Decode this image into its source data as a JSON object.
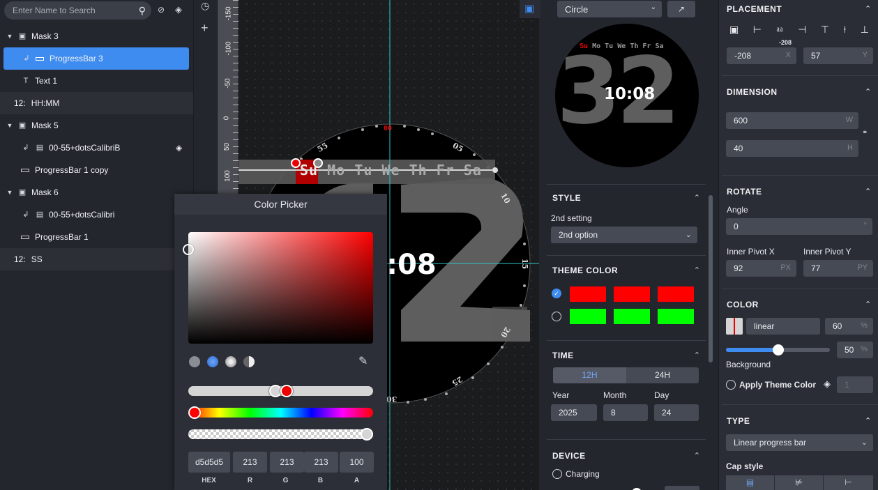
{
  "layers": {
    "search_placeholder": "Enter Name to Search",
    "items": [
      {
        "label": "Mask 3"
      },
      {
        "label": "ProgressBar 3"
      },
      {
        "label": "Text 1"
      },
      {
        "label": "HH:MM",
        "prefix": "12:"
      },
      {
        "label": "Mask 5"
      },
      {
        "label": "00-55+dotsCalibriB"
      },
      {
        "label": "ProgressBar 1 copy"
      },
      {
        "label": "Mask 6"
      },
      {
        "label": "00-55+dotsCalibri"
      },
      {
        "label": "ProgressBar 1"
      },
      {
        "label": "SS",
        "prefix": "12:"
      }
    ]
  },
  "ruler": {
    "ticks": [
      "-150",
      "-100",
      "-50",
      "0",
      "50",
      "100"
    ]
  },
  "canvas": {
    "weekdays": [
      "Su",
      "Mo",
      "Tu",
      "We",
      "Th",
      "Fr",
      "Sa"
    ],
    "time_partial": ":08",
    "big_digit": "2",
    "dial_labels": [
      "00",
      "05",
      "10",
      "15",
      "20",
      "25",
      "30",
      "55"
    ]
  },
  "color_picker": {
    "title": "Color Picker",
    "hex": "d5d5d5",
    "r": "213",
    "g": "213",
    "b": "213",
    "a": "100",
    "labels": {
      "hex": "HEX",
      "r": "R",
      "g": "G",
      "b": "B",
      "a": "A"
    },
    "hue_color": "#ff0000",
    "current_color": "#d5d5d5"
  },
  "preview": {
    "shape_select": "Circle",
    "time": "10:08",
    "big_digits": "32",
    "weekdays": [
      "Su",
      "Mo",
      "Tu",
      "We",
      "Th",
      "Fr",
      "Sa"
    ]
  },
  "style": {
    "header": "STYLE",
    "setting_label": "2nd setting",
    "option": "2nd option"
  },
  "theme": {
    "header": "THEME COLOR",
    "row1": [
      "#ff0000",
      "#ff0000",
      "#ff0000"
    ],
    "row2": [
      "#00ff00",
      "#00ff00",
      "#00ff00"
    ]
  },
  "time": {
    "header": "TIME",
    "mode_12": "12H",
    "mode_24": "24H",
    "year_label": "Year",
    "year": "2025",
    "month_label": "Month",
    "month": "8",
    "day_label": "Day",
    "day": "24"
  },
  "device": {
    "header": "DEVICE",
    "charging": "Charging"
  },
  "placement": {
    "header": "PLACEMENT",
    "x_hint": "-208",
    "x": "-208",
    "x_unit": "X",
    "y": "57",
    "y_unit": "Y"
  },
  "dimension": {
    "header": "DIMENSION",
    "w": "600",
    "w_unit": "W",
    "h": "40",
    "h_unit": "H"
  },
  "rotate": {
    "header": "ROTATE",
    "angle_label": "Angle",
    "angle": "0",
    "angle_unit": "°",
    "pivot_x_label": "Inner Pivot X",
    "pivot_x": "92",
    "pivot_x_unit": "PX",
    "pivot_y_label": "Inner Pivot Y",
    "pivot_y": "77",
    "pivot_y_unit": "PY"
  },
  "color": {
    "header": "COLOR",
    "mode": "linear",
    "percent1": "60",
    "percent_unit": "%",
    "slider_value": 0.5,
    "percent2": "50",
    "background_label": "Background",
    "apply_theme": "Apply Theme Color",
    "theme_index": "1"
  },
  "type": {
    "header": "TYPE",
    "value": "Linear progress bar",
    "cap_style_label": "Cap style"
  }
}
